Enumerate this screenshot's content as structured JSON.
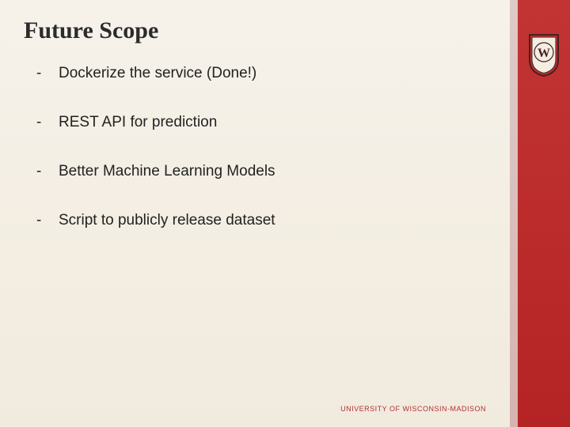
{
  "title": "Future Scope",
  "bullets": [
    "Dockerize the service (Done!)",
    "REST API for prediction",
    "Better Machine Learning Models",
    "Script to publicly release dataset"
  ],
  "footer": "UNIVERSITY OF WISCONSIN-MADISON",
  "brand": {
    "crest_letter": "W"
  },
  "colors": {
    "accent_red": "#b92a2a"
  }
}
